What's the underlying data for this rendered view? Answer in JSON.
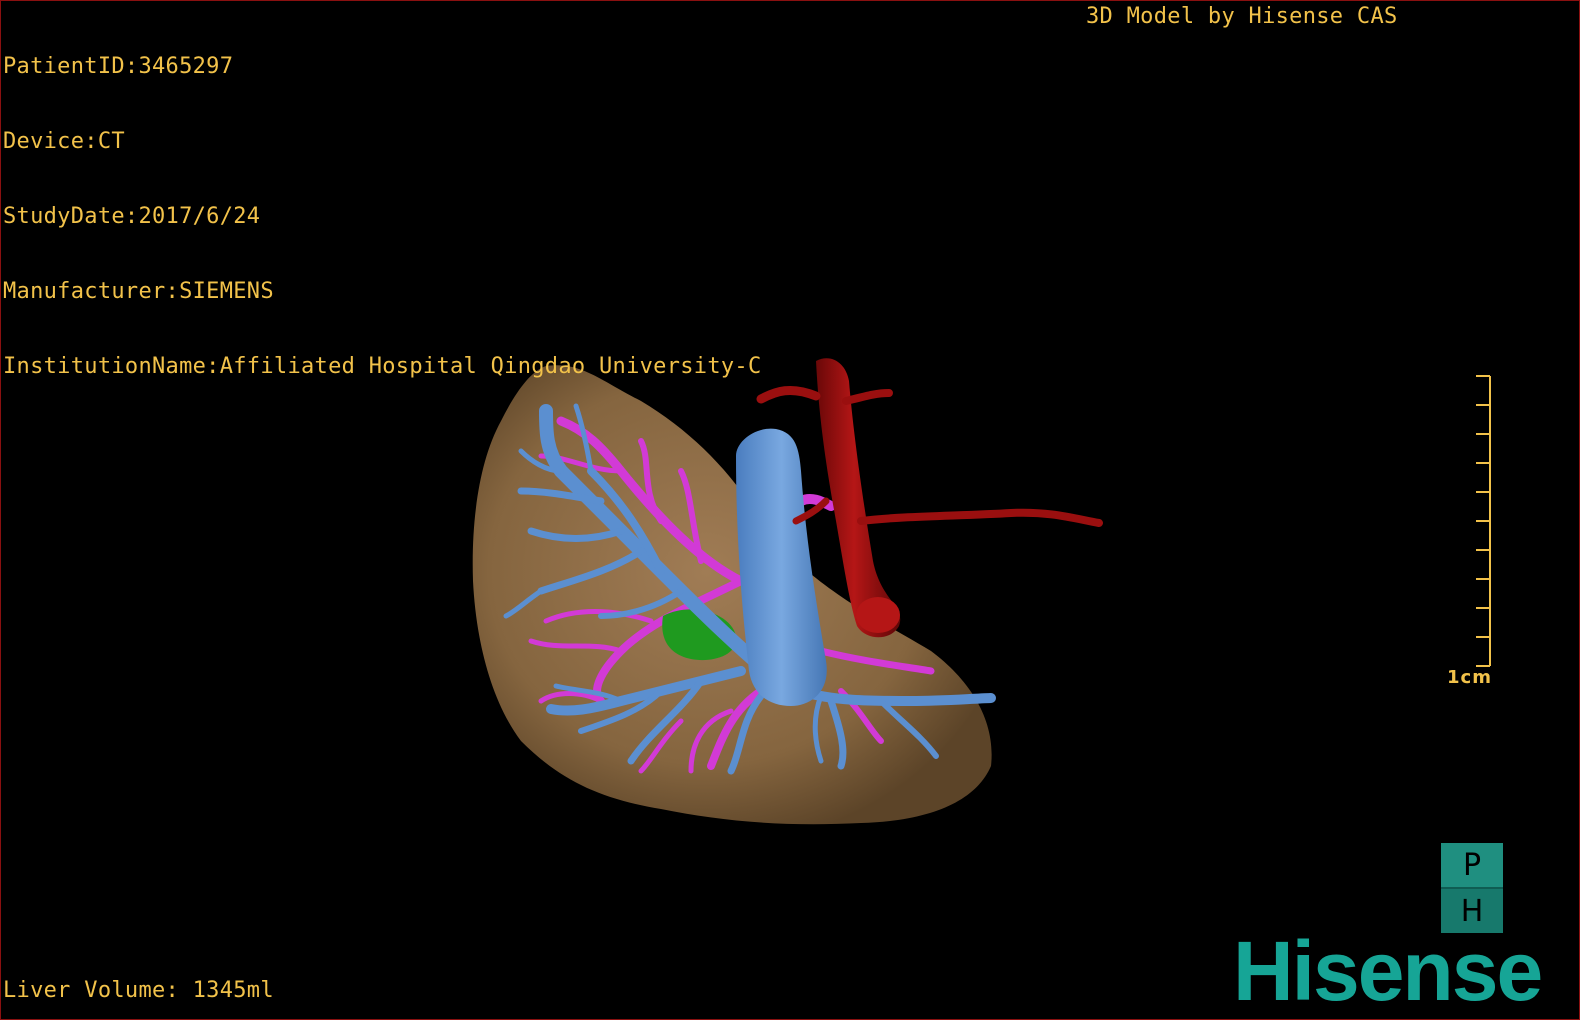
{
  "overlay": {
    "patient_id": "PatientID:3465297",
    "device": "Device:CT",
    "study_date": "StudyDate:2017/6/24",
    "manufacturer": "Manufacturer:SIEMENS",
    "institution": "InstitutionName:Affiliated Hospital Qingdao University-C",
    "model_credit": "3D Model by Hisense CAS",
    "liver_volume": "Liver Volume: 1345ml"
  },
  "scale": {
    "label": "1cm"
  },
  "orientation": {
    "top_face": "P",
    "bottom_face": "H"
  },
  "brand": {
    "logo_text": "Hisense"
  },
  "colors": {
    "overlay_text": "#f2c24a",
    "liver": "#8a6a47",
    "portal_vein": "#5b8fd0",
    "hepatic_vessels": "#d23ad6",
    "aorta": "#9a0f0f",
    "gallbladder": "#1f9a1f",
    "brand": "#16a596"
  }
}
